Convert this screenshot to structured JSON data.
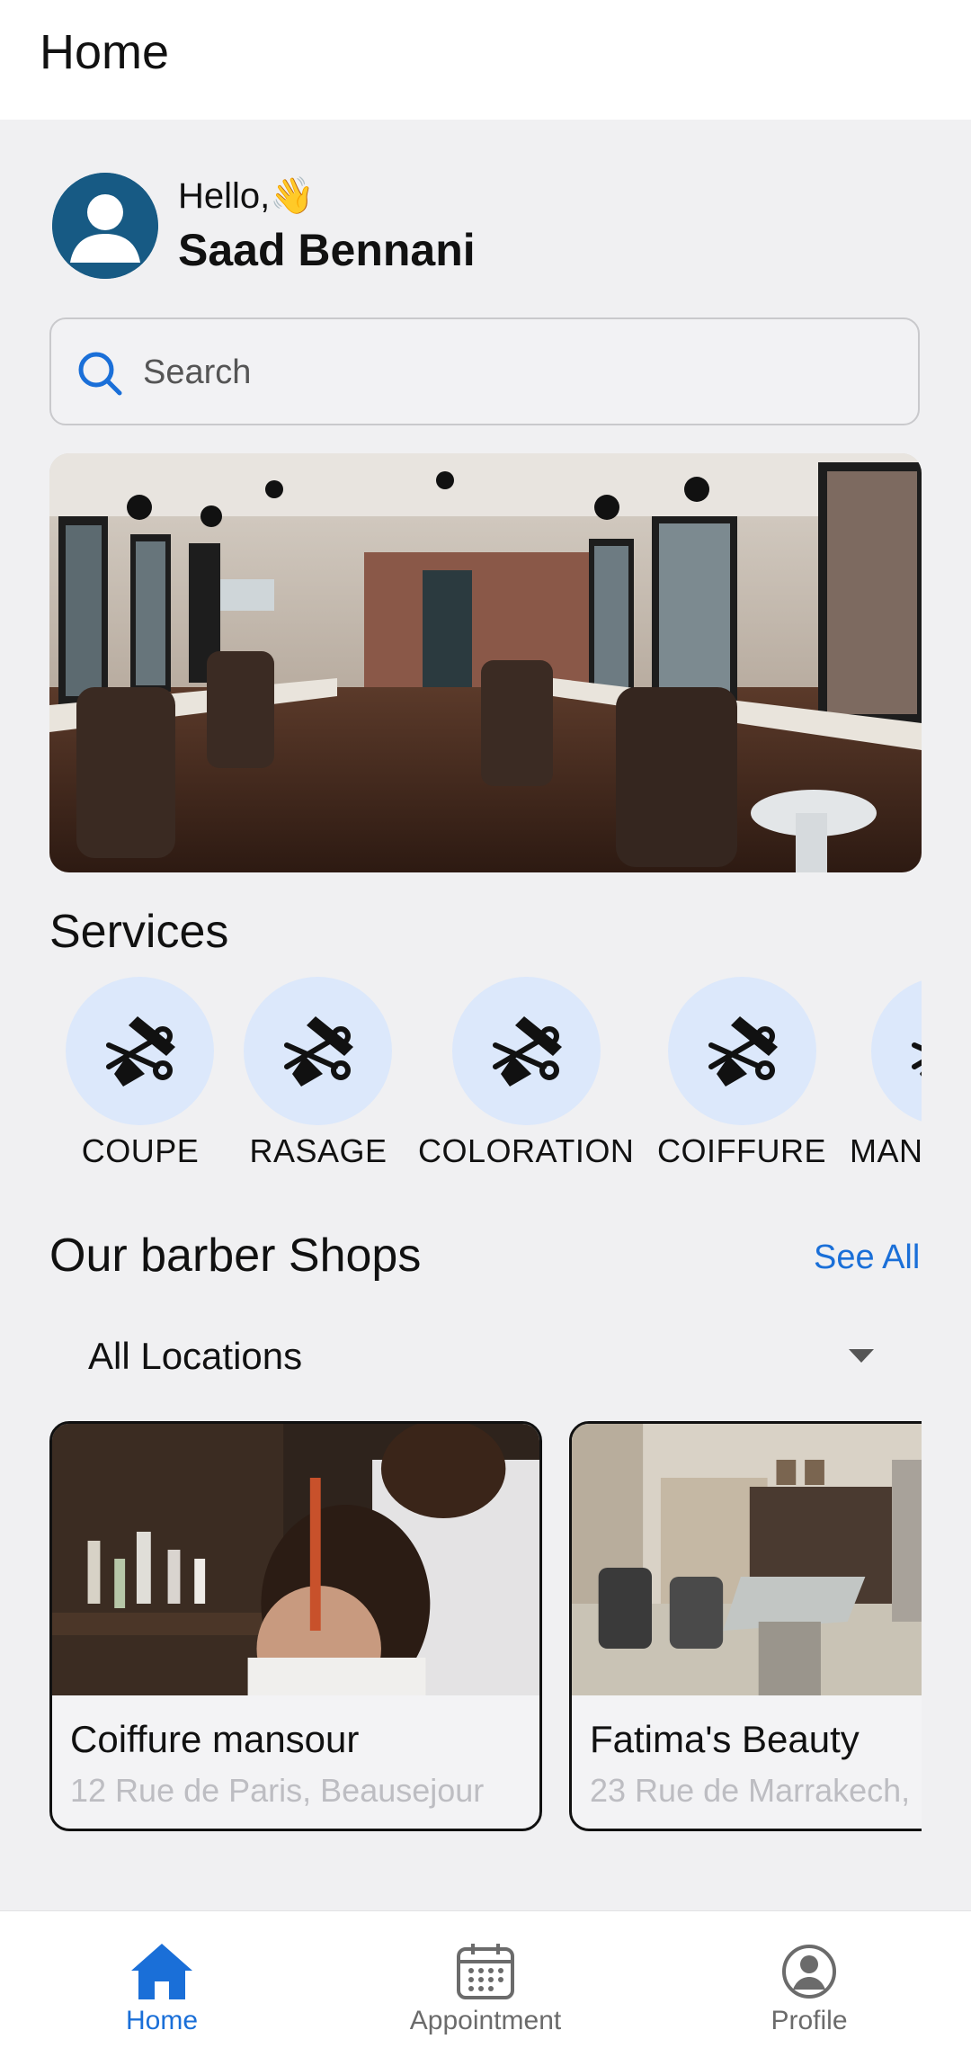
{
  "appbar": {
    "title": "Home"
  },
  "user": {
    "greeting": "Hello,",
    "wave": "👋",
    "name": "Saad Bennani"
  },
  "search": {
    "placeholder": "Search",
    "value": ""
  },
  "sections": {
    "services_title": "Services",
    "shops_title": "Our barber Shops",
    "see_all": "See All"
  },
  "services": [
    {
      "label": "COUPE",
      "icon": "scissors-comb-icon"
    },
    {
      "label": "RASAGE",
      "icon": "scissors-comb-icon"
    },
    {
      "label": "COLORATION",
      "icon": "scissors-comb-icon"
    },
    {
      "label": "COIFFURE",
      "icon": "scissors-comb-icon"
    },
    {
      "label": "MAN",
      "icon": "scissors-comb-icon"
    }
  ],
  "location_filter": {
    "selected": "All Locations"
  },
  "shops": [
    {
      "name": "Coiffure mansour",
      "address": "12 Rue de Paris, Beausejour"
    },
    {
      "name": "Fatima's Beauty",
      "address": "23 Rue de Marrakech,"
    }
  ],
  "bottom_nav": [
    {
      "label": "Home",
      "icon": "home-icon",
      "active": true
    },
    {
      "label": "Appointment",
      "icon": "calendar-icon",
      "active": false
    },
    {
      "label": "Profile",
      "icon": "profile-icon",
      "active": false
    }
  ],
  "colors": {
    "accent": "#1a6fd8",
    "avatar_bg": "#175a84",
    "service_bg": "#dce8fb",
    "inactive_nav": "#6b6b6b"
  }
}
